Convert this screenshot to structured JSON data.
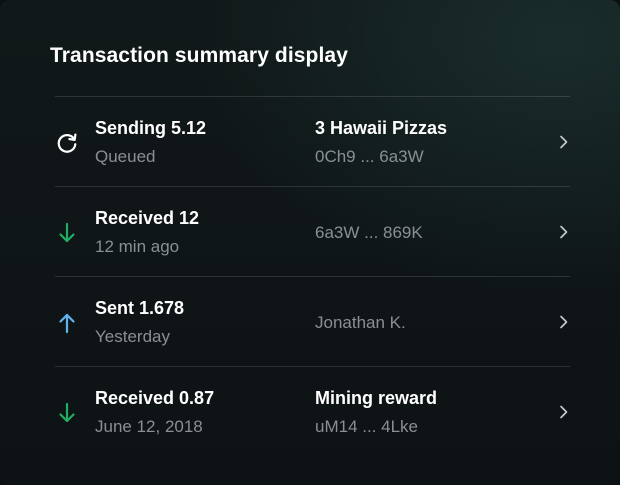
{
  "card": {
    "title": "Transaction summary display"
  },
  "colors": {
    "incoming": "#1fae63",
    "outgoing": "#5fb4f0",
    "pending": "#ffffff",
    "muted_text": "#8a8f91"
  },
  "transactions": [
    {
      "icon": "refresh-icon",
      "primary": "Sending 5.12",
      "secondary": "Queued",
      "counterparty_title": "3 Hawaii Pizzas",
      "counterparty_sub": "0Ch9 ... 6a3W"
    },
    {
      "icon": "arrow-down-icon",
      "primary": "Received 12",
      "secondary": "12 min ago",
      "counterparty_sub": "6a3W ... 869K"
    },
    {
      "icon": "arrow-up-icon",
      "primary": "Sent 1.678",
      "secondary": "Yesterday",
      "counterparty_sub": "Jonathan K."
    },
    {
      "icon": "arrow-down-icon",
      "primary": "Received 0.87",
      "secondary": "June 12, 2018",
      "counterparty_title": "Mining reward",
      "counterparty_sub": "uM14 ... 4Lke"
    }
  ]
}
